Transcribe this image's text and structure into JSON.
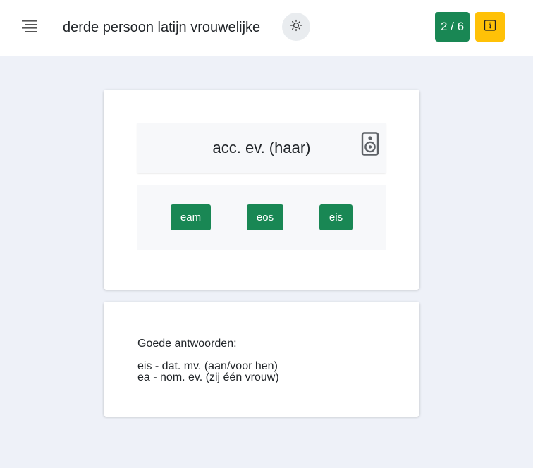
{
  "header": {
    "menu_icon": "hamburger-icon",
    "title": "derde persoon latijn vrouwelijke",
    "theme_icon": "sun-icon",
    "progress": "2 / 6",
    "progress_color": "#198754",
    "info_icon": "info-icon",
    "info_color": "#ffc107"
  },
  "question": {
    "prompt": "acc. ev. (haar)",
    "audio_icon": "speaker-icon",
    "options": [
      "eam",
      "eos",
      "eis"
    ],
    "option_color": "#198754"
  },
  "feedback": {
    "heading": "Goede antwoorden:",
    "answers": [
      "eis - dat. mv. (aan/voor hen)",
      "ea - nom. ev. (zij één vrouw)"
    ]
  }
}
